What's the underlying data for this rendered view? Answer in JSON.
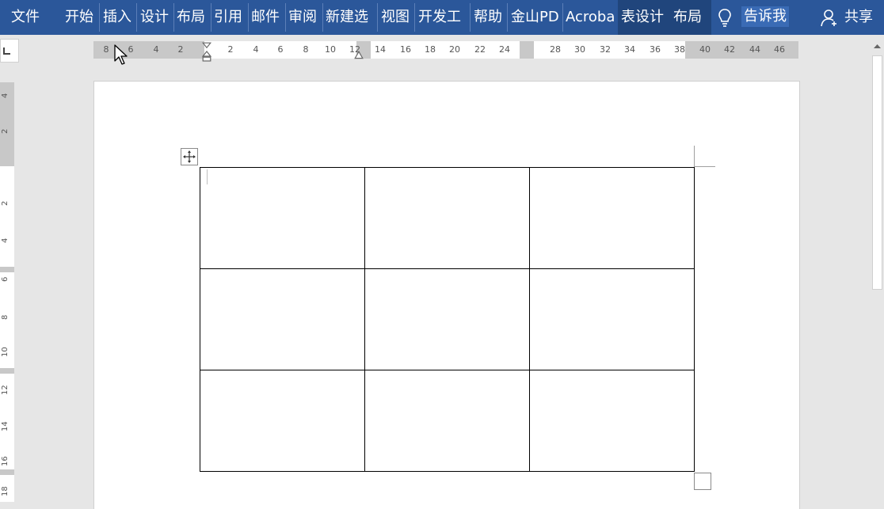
{
  "ribbon": {
    "tabs": [
      {
        "label": "文件"
      },
      {
        "label": "开始"
      },
      {
        "label": "插入"
      },
      {
        "label": "设计"
      },
      {
        "label": "布局"
      },
      {
        "label": "引用"
      },
      {
        "label": "邮件"
      },
      {
        "label": "审阅"
      },
      {
        "label": "新建选"
      },
      {
        "label": "视图"
      },
      {
        "label": "开发工"
      },
      {
        "label": "帮助"
      },
      {
        "label": "金山PD"
      },
      {
        "label": "Acroba"
      },
      {
        "label": "表设计"
      },
      {
        "label": "布局"
      }
    ],
    "tell_me": "告诉我",
    "share": "共享",
    "icons": [
      "lightbulb-icon",
      "person-icon"
    ]
  },
  "ruler": {
    "horizontal_ticks": [
      "8",
      "6",
      "4",
      "2",
      "2",
      "4",
      "6",
      "8",
      "10",
      "12",
      "14",
      "16",
      "18",
      "20",
      "22",
      "24",
      "28",
      "30",
      "32",
      "34",
      "36",
      "38",
      "40",
      "42",
      "44",
      "46"
    ],
    "vertical_ticks": [
      "4",
      "2",
      "2",
      "4",
      "6",
      "8",
      "10",
      "12",
      "14",
      "16",
      "18"
    ]
  },
  "table": {
    "rows": 3,
    "columns": 3,
    "cells": [
      [
        "",
        "",
        ""
      ],
      [
        "",
        "",
        ""
      ],
      [
        "",
        "",
        ""
      ]
    ]
  },
  "colors": {
    "ribbon": "#2b579a",
    "active_tab": "#20457c",
    "workspace": "#e6e6e6",
    "page": "#ffffff"
  }
}
